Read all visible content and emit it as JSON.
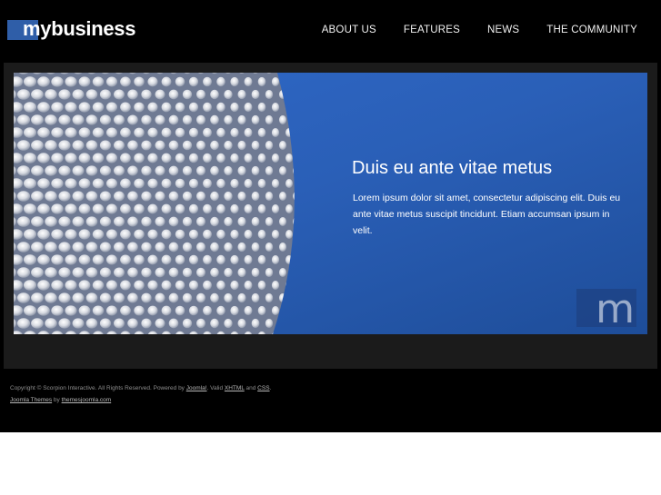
{
  "header": {
    "logo_text": "mybusiness",
    "nav": [
      "ABOUT US",
      "FEATURES",
      "NEWS",
      "THE COMMUNITY"
    ]
  },
  "banner": {
    "title": "Duis eu ante vitae metus",
    "body": "Lorem ipsum dolor sit amet, consectetur adipiscing elit. Duis eu ante vitae metus suscipit tincidunt. Etiam accumsan ipsum in velit.",
    "badge_letter": "m"
  },
  "footer": {
    "line1_prefix": "Copyright © Scorpion Interactive. All Rights Reserved. Powered by ",
    "joomla_link": "Joomla!",
    "line1_mid": ". Valid ",
    "xhtml_link": "XHTML",
    "and_text": " and ",
    "css_link": "CSS",
    "line1_end": ".",
    "themes_link": "Joomla Themes",
    "by_text": " by ",
    "site_link": "themesjoomla.com"
  },
  "colors": {
    "background": "#000000",
    "logo_box": "#2f5ea8",
    "banner_blue": "#2a5fb7",
    "panel": "#1b1b1b"
  }
}
